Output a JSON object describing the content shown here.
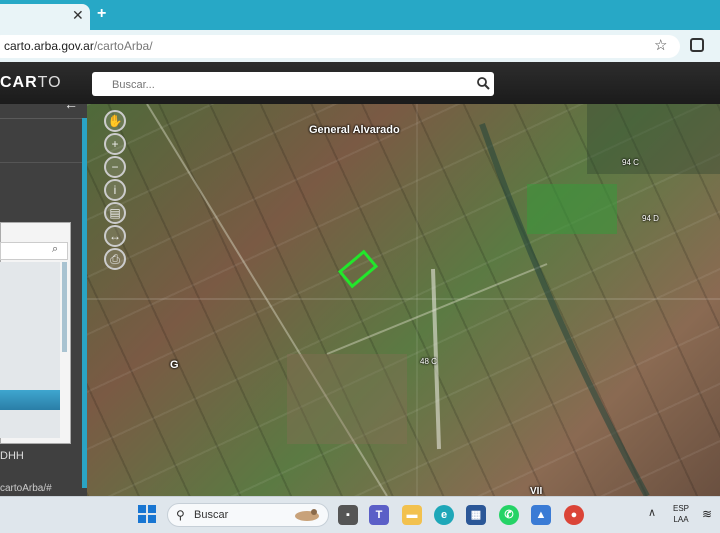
{
  "browser": {
    "tab_close": "✕",
    "new_tab": "+",
    "url_host": "carto.arba.gov.ar",
    "url_path": "/cartoArba/",
    "bookmark_icon": "star-icon",
    "extensions_icon": "extensions-icon"
  },
  "app": {
    "logo_bold": "CAR",
    "logo_light": "TO",
    "search_placeholder": "Buscar...",
    "collapse_icon": "←",
    "panel_text": "DHH",
    "footer_link": "cartoArba/#"
  },
  "map": {
    "labels": {
      "general_alvarado": "General Alvarado",
      "parcel_94c": "94 C",
      "parcel_94d": "94 D",
      "parcel_48c": "48 C",
      "g": "G",
      "vii": "VII"
    },
    "tools": [
      "pan-hand-icon",
      "zoom-in-icon",
      "zoom-out-icon",
      "info-icon",
      "layers-icon",
      "measure-icon",
      "print-icon"
    ],
    "highlight_color": "#22e62b"
  },
  "taskbar": {
    "search_text": "Buscar",
    "lang_line1": "ESP",
    "lang_line2": "LAA",
    "apps": [
      "file-icon",
      "teams-icon",
      "folder-icon",
      "edge-icon",
      "store-icon",
      "whatsapp-icon",
      "photos-icon",
      "chrome-icon"
    ]
  }
}
